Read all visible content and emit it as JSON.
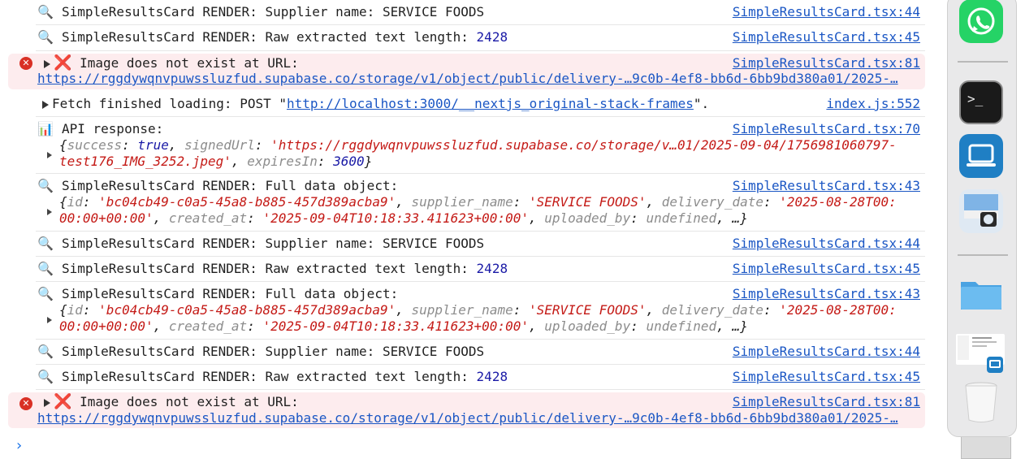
{
  "console": {
    "rows": [
      {
        "id": "r1",
        "prefix": "SimpleResultsCard RENDER: Supplier name: SERVICE FOODS",
        "src": "SimpleResultsCard.tsx:44"
      },
      {
        "id": "r2",
        "prefix": "SimpleResultsCard RENDER: Raw extracted text length: ",
        "num": "2428",
        "src": "SimpleResultsCard.tsx:45"
      },
      {
        "id": "r3",
        "prefix": "Image does not exist at URL:",
        "url": "https://rggdywqnvpuwssluzfud.supabase.co/storage/v1/object/public/delivery-…9c0b-4ef8-bb6d-6bb9bd380a01/2025-…",
        "src": "SimpleResultsCard.tsx:81"
      },
      {
        "id": "r4",
        "prefix": "Fetch finished loading: POST \"",
        "url": "http://localhost:3000/__nextjs_original-stack-frames",
        "suffix": "\".",
        "src": "index.js:552"
      },
      {
        "id": "r5",
        "prefix": "API response:",
        "src": "SimpleResultsCard.tsx:70",
        "obj1": {
          "k1": "success",
          "v1": "true",
          "k2": "signedUrl",
          "v2": "'https://rggdywqnvpuwssluzfud.supabase.co/storage/v…01/2025-09-04/1756981060797-",
          "v2b": "test176_IMG_3252.jpeg'",
          "k3": "expiresIn",
          "v3": "3600"
        }
      },
      {
        "id": "r6",
        "prefix": "SimpleResultsCard RENDER: Full data object:",
        "src": "SimpleResultsCard.tsx:43",
        "obj": {
          "k1": "id",
          "v1": "'bc04cb49-c0a5-45a8-b885-457d389acba9'",
          "k2": "supplier_name",
          "v2": "'SERVICE FOODS'",
          "k3": "delivery_date",
          "v3": "'2025-08-28T00:",
          "v3b": "00:00+00:00'",
          "k4": "created_at",
          "v4": "'2025-09-04T10:18:33.411623+00:00'",
          "k5": "uploaded_by",
          "v5": "undefined",
          "tail": ", …}"
        }
      },
      {
        "id": "r7",
        "prefix": "SimpleResultsCard RENDER: Supplier name: SERVICE FOODS",
        "src": "SimpleResultsCard.tsx:44"
      },
      {
        "id": "r8",
        "prefix": "SimpleResultsCard RENDER: Raw extracted text length: ",
        "num": "2428",
        "src": "SimpleResultsCard.tsx:45"
      },
      {
        "id": "r9",
        "prefix": "SimpleResultsCard RENDER: Full data object:",
        "src": "SimpleResultsCard.tsx:43"
      },
      {
        "id": "r10",
        "prefix": "SimpleResultsCard RENDER: Supplier name: SERVICE FOODS",
        "src": "SimpleResultsCard.tsx:44"
      },
      {
        "id": "r11",
        "prefix": "SimpleResultsCard RENDER: Raw extracted text length: ",
        "num": "2428",
        "src": "SimpleResultsCard.tsx:45"
      },
      {
        "id": "r12",
        "prefix": "Image does not exist at URL:",
        "url": "https://rggdywqnvpuwssluzfud.supabase.co/storage/v1/object/public/delivery-…9c0b-4ef8-bb6d-6bb9bd380a01/2025-…",
        "src": "SimpleResultsCard.tsx:81"
      }
    ],
    "prompt_glyph": "›"
  },
  "dock": {
    "apps": [
      {
        "name": "WhatsApp",
        "icon": "whatsapp-icon"
      },
      {
        "name": "Terminal",
        "icon": "terminal-icon"
      },
      {
        "name": "Screen Sharing",
        "icon": "screen-sharing-icon"
      },
      {
        "name": "Preview",
        "icon": "preview-icon"
      },
      {
        "name": "Folder",
        "icon": "folder-icon"
      },
      {
        "name": "Document window",
        "icon": "document-window-icon"
      },
      {
        "name": "Trash",
        "icon": "trash-icon"
      }
    ]
  },
  "colors": {
    "error_bg": "#fdecee",
    "link": "#1a56c4",
    "string": "#c41a16",
    "number": "#1a1aa6"
  }
}
